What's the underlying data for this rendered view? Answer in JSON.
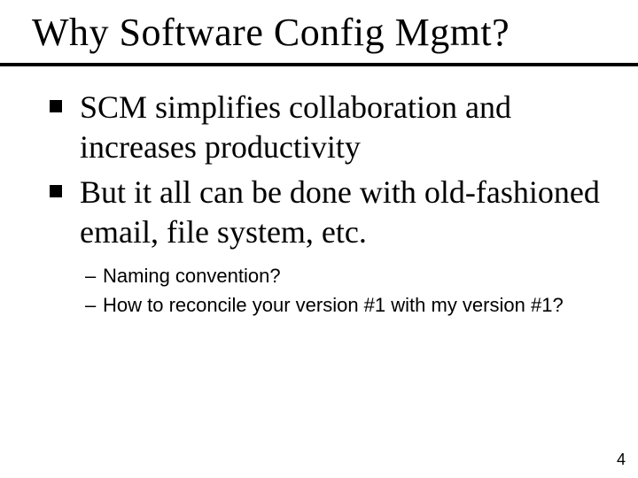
{
  "title": "Why Software Config Mgmt?",
  "bullets": {
    "level1": [
      "SCM simplifies collaboration and increases productivity",
      "But it all can be done with old-fashioned email, file system, etc."
    ],
    "level2": [
      "Naming convention?",
      "How to reconcile your version #1 with my version #1?"
    ]
  },
  "page_number": "4"
}
